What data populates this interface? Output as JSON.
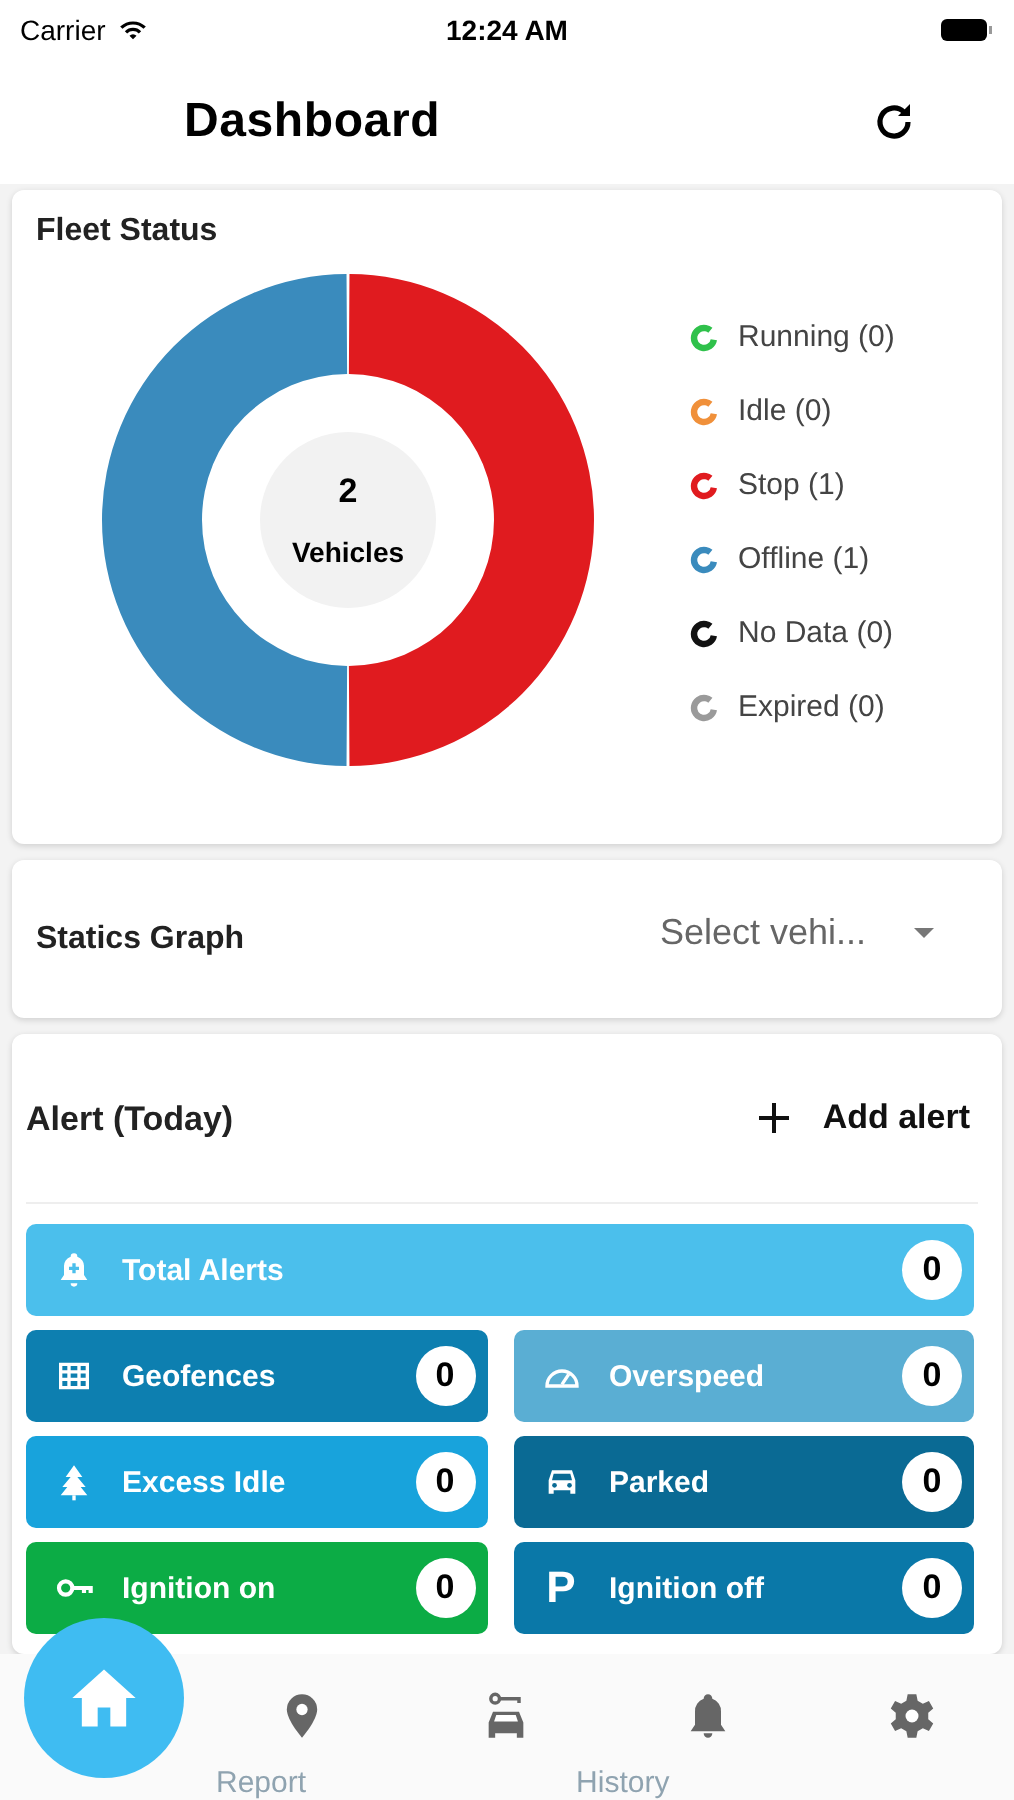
{
  "status_bar": {
    "carrier": "Carrier",
    "time": "12:24 AM"
  },
  "header": {
    "title": "Dashboard"
  },
  "fleet_status": {
    "title": "Fleet Status",
    "center_count": "2",
    "center_label": "Vehicles",
    "legend": [
      {
        "color": "#2fc14b"
      },
      {
        "color": "#f0903a"
      },
      {
        "color": "#e01b1f"
      },
      {
        "color": "#3a8bbd"
      },
      {
        "color": "#111111"
      },
      {
        "color": "#9a9a9a"
      }
    ],
    "chart_data": {
      "type": "donut",
      "categories": [
        "Running (0)",
        "Idle (0)",
        "Stop (1)",
        "Offline (1)",
        "No Data (0)",
        "Expired (0)"
      ],
      "values": [
        0,
        0,
        1,
        1,
        0,
        0
      ]
    }
  },
  "statics_graph": {
    "title": "Statics Graph",
    "vehicle_select": {
      "placeholder": "Select vehi..."
    }
  },
  "alerts": {
    "title": "Alert (Today)",
    "add_button": "Add alert",
    "tiles": [
      {
        "kind": "total",
        "label": "Total Alerts",
        "count": "0",
        "color": "#4bbfec"
      },
      {
        "kind": "geofence",
        "label": "Geofences",
        "count": "0",
        "color": "#0d7fb0"
      },
      {
        "kind": "overspeed",
        "label": "Overspeed",
        "count": "0",
        "color": "#5aaed3"
      },
      {
        "kind": "idle",
        "label": "Excess Idle",
        "count": "0",
        "color": "#18a3dc"
      },
      {
        "kind": "parked",
        "label": "Parked",
        "count": "0",
        "color": "#0a6a94"
      },
      {
        "kind": "ignition_on",
        "label": "Ignition on",
        "count": "0",
        "color": "#0cac45"
      },
      {
        "kind": "ignition_off",
        "label": "Ignition off",
        "count": "0",
        "color": "#0a78a8",
        "symbol": "P"
      }
    ]
  },
  "tab_bar": {
    "tabs": [
      {
        "kind": "home",
        "selected": true
      },
      {
        "kind": "location",
        "selected": false
      },
      {
        "kind": "vehicle",
        "selected": false
      },
      {
        "kind": "alerts",
        "selected": false
      },
      {
        "kind": "settings",
        "selected": false
      }
    ],
    "ghost_labels": [
      "Report",
      "History"
    ]
  }
}
